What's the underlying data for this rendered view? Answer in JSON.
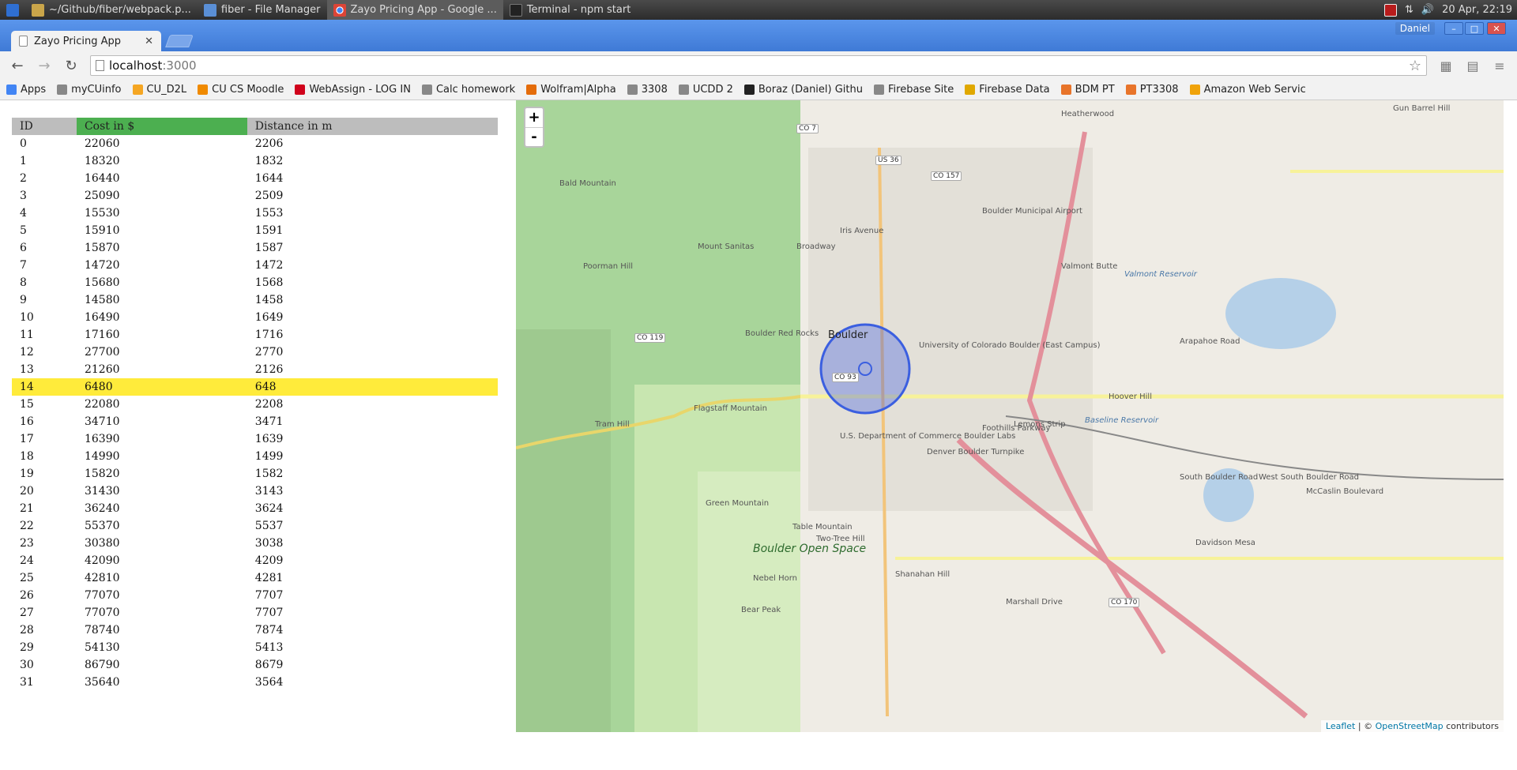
{
  "taskbar": {
    "items": [
      {
        "label": "~/Github/fiber/webpack.p..."
      },
      {
        "label": "fiber - File Manager"
      },
      {
        "label": "Zayo Pricing App - Google ..."
      },
      {
        "label": "Terminal - npm start"
      }
    ],
    "clock": "20 Apr, 22:19"
  },
  "browser": {
    "tab_title": "Zayo Pricing App",
    "user": "Daniel",
    "url_host": "localhost",
    "url_port": ":3000"
  },
  "bookmarks": [
    {
      "label": "Apps",
      "color": "#4285f4"
    },
    {
      "label": "myCUinfo",
      "color": "#888888"
    },
    {
      "label": "CU_D2L",
      "color": "#f5a623"
    },
    {
      "label": "CU CS Moodle",
      "color": "#f08a00"
    },
    {
      "label": "WebAssign - LOG IN",
      "color": "#d0021b"
    },
    {
      "label": "Calc homework",
      "color": "#888888"
    },
    {
      "label": "Wolfram|Alpha",
      "color": "#e46c0a"
    },
    {
      "label": "3308",
      "color": "#888888"
    },
    {
      "label": "UCDD 2",
      "color": "#888888"
    },
    {
      "label": "Boraz (Daniel) Githu",
      "color": "#222222"
    },
    {
      "label": "Firebase Site",
      "color": "#888888"
    },
    {
      "label": "Firebase Data",
      "color": "#e0a800"
    },
    {
      "label": "BDM PT",
      "color": "#e8742a"
    },
    {
      "label": "PT3308",
      "color": "#e8742a"
    },
    {
      "label": "Amazon Web Servic",
      "color": "#f0a30a"
    }
  ],
  "table": {
    "headers": {
      "id": "ID",
      "cost": "Cost in $",
      "distance": "Distance in m"
    },
    "highlight_row": 14,
    "rows": [
      {
        "id": "0",
        "cost": "22060",
        "distance": "2206"
      },
      {
        "id": "1",
        "cost": "18320",
        "distance": "1832"
      },
      {
        "id": "2",
        "cost": "16440",
        "distance": "1644"
      },
      {
        "id": "3",
        "cost": "25090",
        "distance": "2509"
      },
      {
        "id": "4",
        "cost": "15530",
        "distance": "1553"
      },
      {
        "id": "5",
        "cost": "15910",
        "distance": "1591"
      },
      {
        "id": "6",
        "cost": "15870",
        "distance": "1587"
      },
      {
        "id": "7",
        "cost": "14720",
        "distance": "1472"
      },
      {
        "id": "8",
        "cost": "15680",
        "distance": "1568"
      },
      {
        "id": "9",
        "cost": "14580",
        "distance": "1458"
      },
      {
        "id": "10",
        "cost": "16490",
        "distance": "1649"
      },
      {
        "id": "11",
        "cost": "17160",
        "distance": "1716"
      },
      {
        "id": "12",
        "cost": "27700",
        "distance": "2770"
      },
      {
        "id": "13",
        "cost": "21260",
        "distance": "2126"
      },
      {
        "id": "14",
        "cost": "6480",
        "distance": "648"
      },
      {
        "id": "15",
        "cost": "22080",
        "distance": "2208"
      },
      {
        "id": "16",
        "cost": "34710",
        "distance": "3471"
      },
      {
        "id": "17",
        "cost": "16390",
        "distance": "1639"
      },
      {
        "id": "18",
        "cost": "14990",
        "distance": "1499"
      },
      {
        "id": "19",
        "cost": "15820",
        "distance": "1582"
      },
      {
        "id": "20",
        "cost": "31430",
        "distance": "3143"
      },
      {
        "id": "21",
        "cost": "36240",
        "distance": "3624"
      },
      {
        "id": "22",
        "cost": "55370",
        "distance": "5537"
      },
      {
        "id": "23",
        "cost": "30380",
        "distance": "3038"
      },
      {
        "id": "24",
        "cost": "42090",
        "distance": "4209"
      },
      {
        "id": "25",
        "cost": "42810",
        "distance": "4281"
      },
      {
        "id": "26",
        "cost": "77070",
        "distance": "7707"
      },
      {
        "id": "27",
        "cost": "77070",
        "distance": "7707"
      },
      {
        "id": "28",
        "cost": "78740",
        "distance": "7874"
      },
      {
        "id": "29",
        "cost": "54130",
        "distance": "5413"
      },
      {
        "id": "30",
        "cost": "86790",
        "distance": "8679"
      },
      {
        "id": "31",
        "cost": "35640",
        "distance": "3564"
      }
    ]
  },
  "map": {
    "zoom_in": "+",
    "zoom_out": "-",
    "attribution_link": "Leaflet",
    "attribution_sep": " | © ",
    "attribution_osm": "OpenStreetMap",
    "attribution_tail": " contributors",
    "labels": [
      "Boulder",
      "Bald Mountain",
      "Mount Sanitas",
      "Poorman Hill",
      "Flagstaff Mountain",
      "Tram Hill",
      "Green Mountain",
      "Table Mountain",
      "Boulder Open Space",
      "Nebel Horn",
      "Bear Peak",
      "Valmont Reservoir",
      "Baseline Reservoir",
      "Hoover Hill",
      "Heatherwood",
      "Gun Barrel Hill",
      "University of Colorado Boulder (East Campus)",
      "U.S. Department of Commerce Boulder Labs",
      "Lemons Strip",
      "Davidson Mesa",
      "Shanahan Hill",
      "Two-Tree Hill",
      "Boulder Municipal Airport",
      "Valmont Butte",
      "Iris Avenue",
      "Arapahoe Road",
      "South Boulder Road",
      "West South Boulder Road",
      "Denver Boulder Turnpike",
      "Broadway",
      "Foothills Parkway",
      "Boulder Red Rocks",
      "Marshall Drive",
      "McCaslin Boulevard"
    ],
    "shields": [
      "CO 7",
      "US 36",
      "CO 119",
      "CO 157",
      "CO 93",
      "CO 170"
    ]
  }
}
